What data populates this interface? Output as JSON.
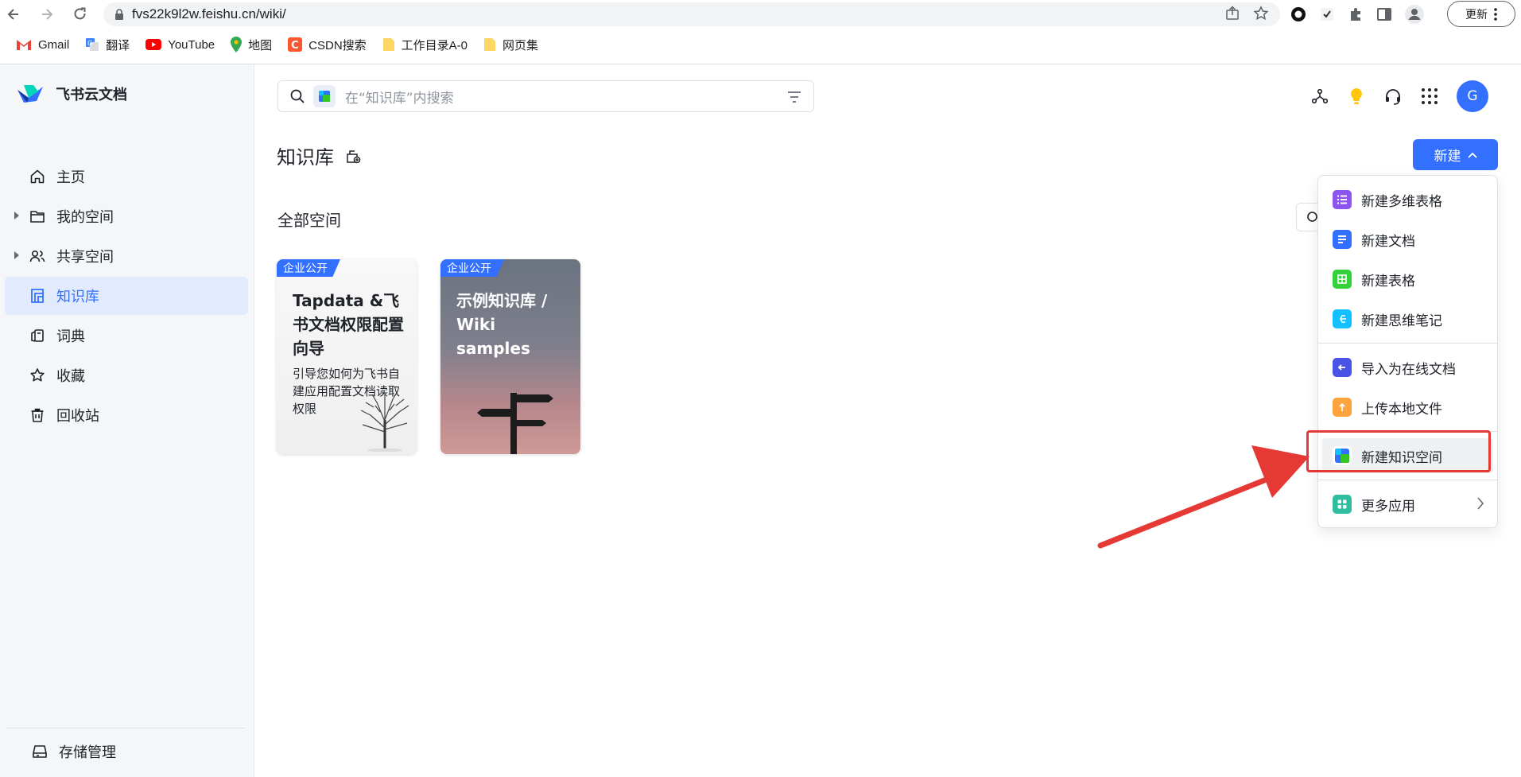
{
  "browser": {
    "url": "fvs22k9l2w.feishu.cn/wiki/",
    "update_label": "更新",
    "bookmarks": [
      {
        "label": "Gmail",
        "icon": "gmail-icon"
      },
      {
        "label": "翻译",
        "icon": "translate-icon"
      },
      {
        "label": "YouTube",
        "icon": "youtube-icon"
      },
      {
        "label": "地图",
        "icon": "maps-icon"
      },
      {
        "label": "CSDN搜索",
        "icon": "csdn-icon"
      },
      {
        "label": "工作目录A-0",
        "icon": "folder-icon"
      },
      {
        "label": "网页集",
        "icon": "folder-icon"
      }
    ]
  },
  "app": {
    "name": "飞书云文档",
    "avatar_letter": "G"
  },
  "sidebar": {
    "items": [
      {
        "label": "主页",
        "icon": "home-icon"
      },
      {
        "label": "我的空间",
        "icon": "folder-icon"
      },
      {
        "label": "共享空间",
        "icon": "users-icon"
      },
      {
        "label": "知识库",
        "icon": "wiki-icon"
      },
      {
        "label": "词典",
        "icon": "dictionary-icon"
      },
      {
        "label": "收藏",
        "icon": "star-icon"
      },
      {
        "label": "回收站",
        "icon": "trash-icon"
      }
    ],
    "storage_label": "存储管理"
  },
  "search": {
    "placeholder": "在“知识库”内搜索"
  },
  "main": {
    "title": "知识库",
    "new_button": "新建",
    "section_title": "全部空间",
    "cards": [
      {
        "badge": "企业公开",
        "title": "Tapdata &飞书文档权限配置向导",
        "desc": "引导您如何为飞书自建应用配置文档读取权限"
      },
      {
        "badge": "企业公开",
        "title": "示例知识库 / Wiki samples",
        "desc": ""
      }
    ]
  },
  "menu": {
    "items": [
      {
        "label": "新建多维表格",
        "icon": "bitable-icon",
        "color": "#8d55ed"
      },
      {
        "label": "新建文档",
        "icon": "doc-icon",
        "color": "#3370ff"
      },
      {
        "label": "新建表格",
        "icon": "sheet-icon",
        "color": "#33d13a"
      },
      {
        "label": "新建思维笔记",
        "icon": "mindnote-icon",
        "color": "#14c0ff"
      },
      {
        "label": "导入为在线文档",
        "icon": "import-icon",
        "color": "#4954e6"
      },
      {
        "label": "上传本地文件",
        "icon": "upload-icon",
        "color": "#ffa33d"
      },
      {
        "label": "新建知识空间",
        "icon": "wiki-space-icon",
        "color": "#3370ff"
      },
      {
        "label": "更多应用",
        "icon": "apps-icon",
        "color": "#2dbea0"
      }
    ]
  },
  "colors": {
    "accent": "#3370ff",
    "annotation": "#e53935"
  }
}
